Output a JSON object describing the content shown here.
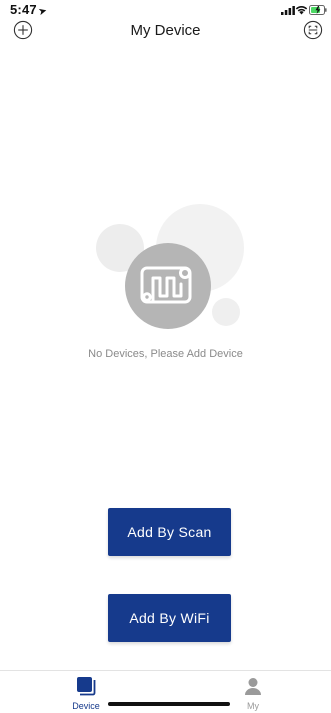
{
  "status_bar": {
    "time": "5:47",
    "location_arrow": "➤"
  },
  "nav": {
    "title": "My Device",
    "add_icon": "plus-circle-icon",
    "scan_icon": "scan-icon"
  },
  "empty_state": {
    "message": "No Devices, Please Add Device",
    "graphic_icon": "device-heater-icon"
  },
  "actions": {
    "add_by_scan": "Add By Scan",
    "add_by_wifi": "Add By WiFi"
  },
  "tabs": [
    {
      "label": "Device",
      "icon": "device-icon",
      "active": true
    },
    {
      "label": "My",
      "icon": "user-icon",
      "active": false
    }
  ],
  "colors": {
    "primary": "#163a8c",
    "muted_text": "#8a8a8a",
    "graphic_grey": "#b5b5b5"
  }
}
